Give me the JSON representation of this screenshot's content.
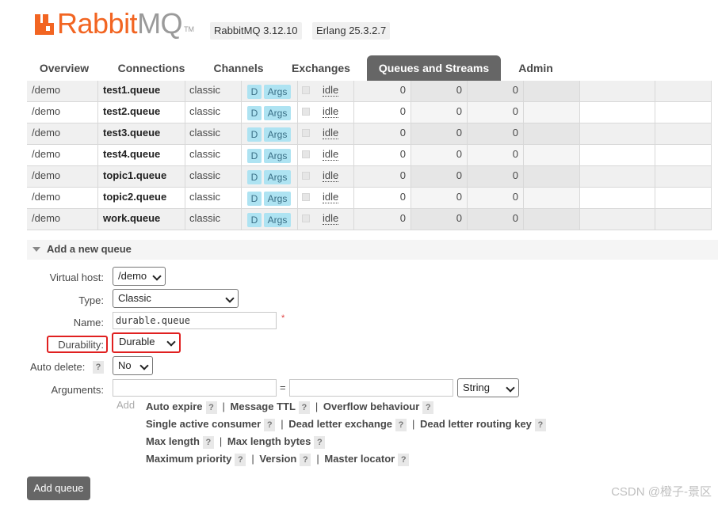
{
  "header": {
    "logo_rabbit": "Rabbit",
    "logo_mq": "MQ",
    "logo_tm": "TM",
    "version": "RabbitMQ 3.12.10",
    "erlang": "Erlang 25.3.2.7"
  },
  "tabs": [
    {
      "label": "Overview"
    },
    {
      "label": "Connections"
    },
    {
      "label": "Channels"
    },
    {
      "label": "Exchanges"
    },
    {
      "label": "Queues and Streams",
      "active": true
    },
    {
      "label": "Admin"
    }
  ],
  "queues": [
    {
      "vhost": "/demo",
      "name": "test1.queue",
      "type": "classic",
      "feature": "D",
      "args": "Args",
      "state": "idle",
      "ready": "0",
      "unacked": "0",
      "total": "0"
    },
    {
      "vhost": "/demo",
      "name": "test2.queue",
      "type": "classic",
      "feature": "D",
      "args": "Args",
      "state": "idle",
      "ready": "0",
      "unacked": "0",
      "total": "0"
    },
    {
      "vhost": "/demo",
      "name": "test3.queue",
      "type": "classic",
      "feature": "D",
      "args": "Args",
      "state": "idle",
      "ready": "0",
      "unacked": "0",
      "total": "0"
    },
    {
      "vhost": "/demo",
      "name": "test4.queue",
      "type": "classic",
      "feature": "D",
      "args": "Args",
      "state": "idle",
      "ready": "0",
      "unacked": "0",
      "total": "0"
    },
    {
      "vhost": "/demo",
      "name": "topic1.queue",
      "type": "classic",
      "feature": "D",
      "args": "Args",
      "state": "idle",
      "ready": "0",
      "unacked": "0",
      "total": "0"
    },
    {
      "vhost": "/demo",
      "name": "topic2.queue",
      "type": "classic",
      "feature": "D",
      "args": "Args",
      "state": "idle",
      "ready": "0",
      "unacked": "0",
      "total": "0"
    },
    {
      "vhost": "/demo",
      "name": "work.queue",
      "type": "classic",
      "feature": "D",
      "args": "Args",
      "state": "idle",
      "ready": "0",
      "unacked": "0",
      "total": "0"
    }
  ],
  "add_queue": {
    "section_title": "Add a new queue",
    "virtual_host_label": "Virtual host:",
    "virtual_host_value": "/demo",
    "type_label": "Type:",
    "type_value": "Classic",
    "name_label": "Name:",
    "name_value": "durable.queue",
    "required_mark": "*",
    "durability_label": "Durability:",
    "durability_value": "Durable",
    "auto_delete_label": "Auto delete:",
    "auto_delete_value": "No",
    "arguments_label": "Arguments:",
    "equals": "=",
    "arg_type_value": "String",
    "add_link": "Add",
    "help": "?",
    "separator": "|",
    "hints_row1": [
      "Auto expire",
      "Message TTL",
      "Overflow behaviour"
    ],
    "hints_row2": [
      "Single active consumer",
      "Dead letter exchange",
      "Dead letter routing key"
    ],
    "hints_row3": [
      "Max length",
      "Max length bytes"
    ],
    "hints_row4": [
      "Maximum priority",
      "Version",
      "Master locator"
    ],
    "submit_label": "Add queue"
  },
  "watermark": "CSDN @橙子-景区",
  "colors": {
    "brand_orange": "#f26522",
    "active_tab": "#666666",
    "tag_bg": "#aee3f2",
    "highlight_red": "#e02020"
  }
}
